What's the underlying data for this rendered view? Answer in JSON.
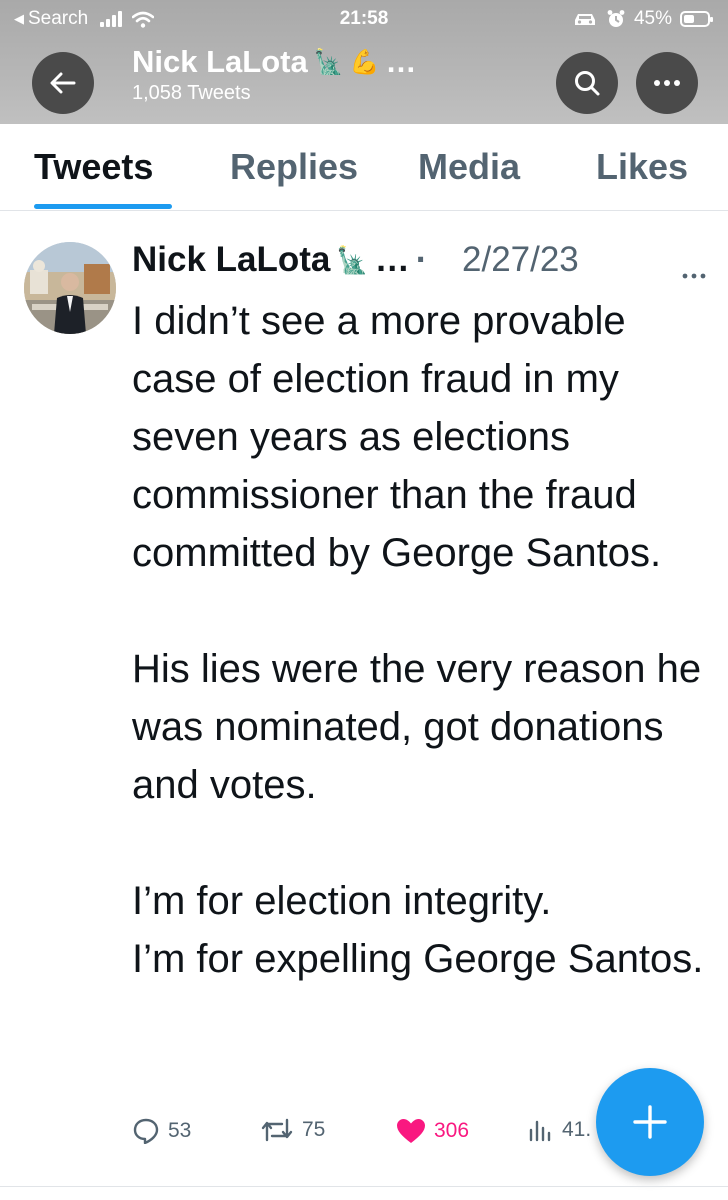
{
  "status_bar": {
    "back_app": "Search",
    "time": "21:58",
    "battery": "45%",
    "battery_level": 0.45
  },
  "header": {
    "name": "Nick LaLota",
    "name_suffix": "…",
    "tweet_count": "1,058 Tweets",
    "icons": [
      "back-arrow-icon",
      "search-icon",
      "more-icon",
      "statue-of-liberty-emoji",
      "flexed-biceps-emoji"
    ]
  },
  "tabs": [
    {
      "label": "Tweets",
      "active": true
    },
    {
      "label": "Replies",
      "active": false
    },
    {
      "label": "Media",
      "active": false
    },
    {
      "label": "Likes",
      "active": false
    }
  ],
  "tweet": {
    "author": "Nick LaLota",
    "author_suffix": "…",
    "separator": "·",
    "date": "2/27/23",
    "text": "I didn’t see a more provable case of election fraud in my seven years as elections commissioner than the fraud committed by George Santos.\n\nHis lies were the very reason he was nominated, got donations and votes.\n\nI’m for election integrity.\nI’m for expelling George Santos.",
    "replies": "53",
    "retweets": "75",
    "likes": "306",
    "views": "41.",
    "like_color": "#f91880"
  },
  "colors": {
    "accent": "#1d9bf0",
    "text": "#0f1419",
    "secondary": "#536471"
  }
}
